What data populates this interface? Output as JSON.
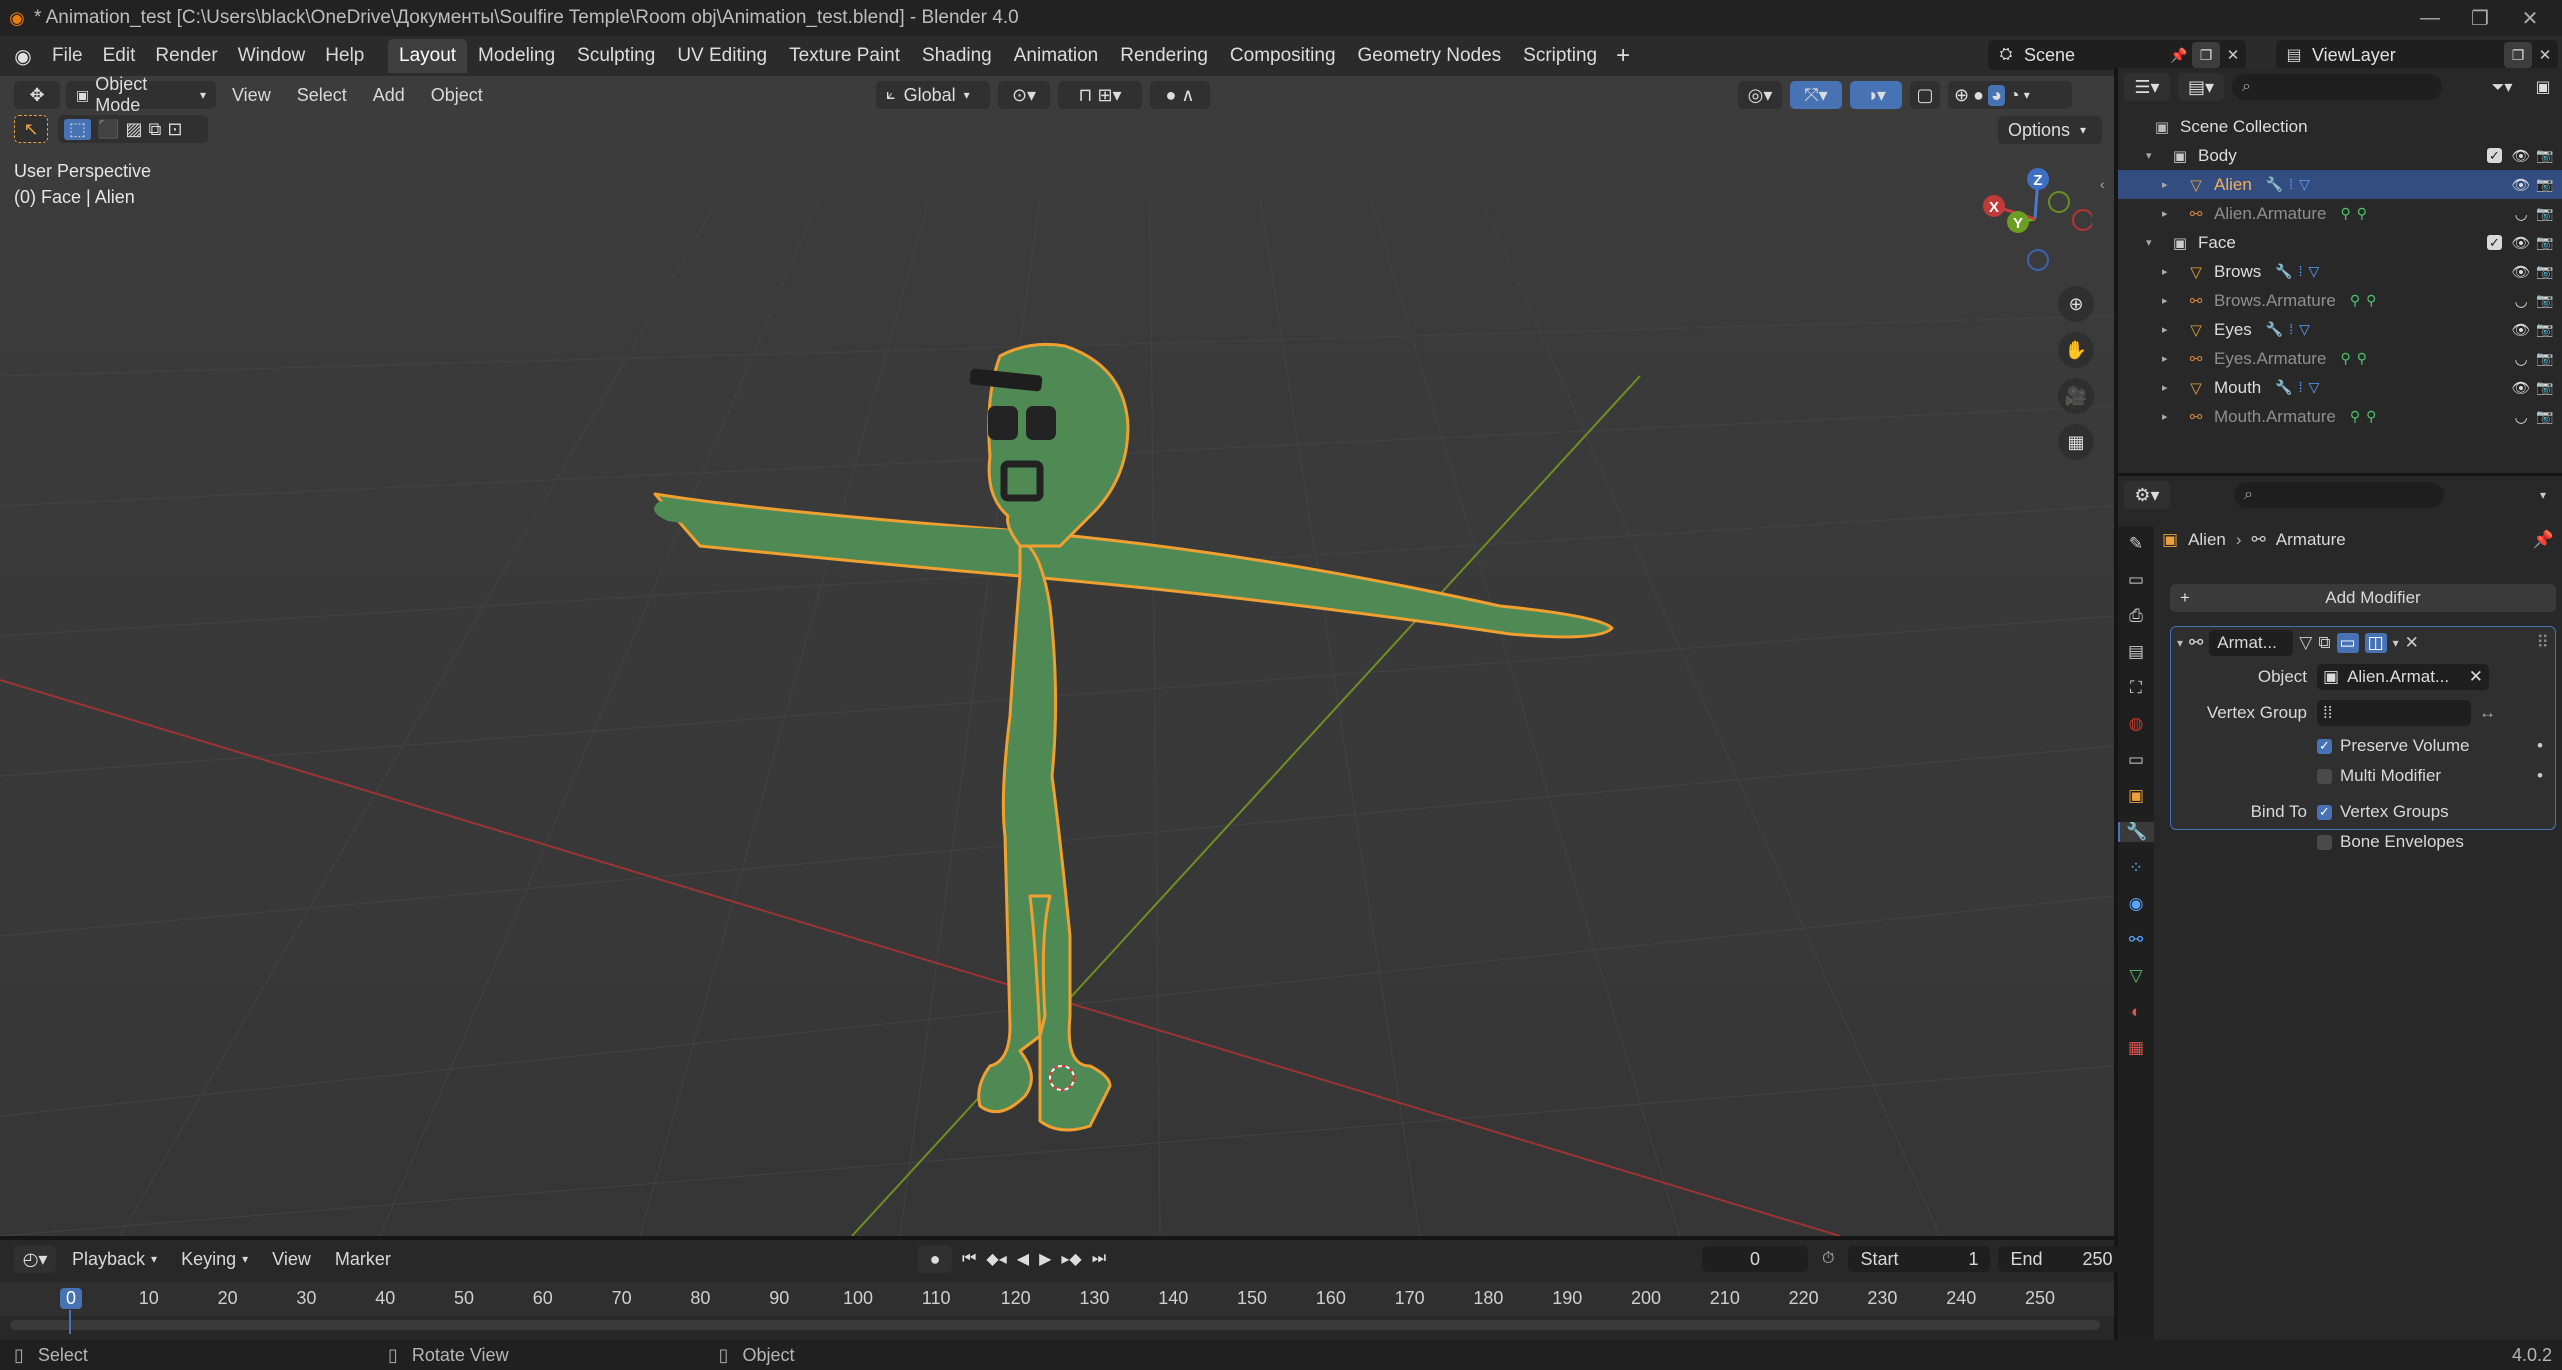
{
  "window": {
    "title": "* Animation_test [C:\\Users\\black\\OneDrive\\Документы\\Soulfire Temple\\Room obj\\Animation_test.blend] - Blender 4.0",
    "minimize": "—",
    "maximize": "❐",
    "close": "✕"
  },
  "menubar": {
    "items": [
      "File",
      "Edit",
      "Render",
      "Window",
      "Help"
    ]
  },
  "workspaces": [
    "Layout",
    "Modeling",
    "Sculpting",
    "UV Editing",
    "Texture Paint",
    "Shading",
    "Animation",
    "Rendering",
    "Compositing",
    "Geometry Nodes",
    "Scripting"
  ],
  "add_workspace": "+",
  "scene": {
    "label": "Scene",
    "view_layer": "ViewLayer"
  },
  "viewport_header": {
    "mode": "Object Mode",
    "menus": [
      "View",
      "Select",
      "Add",
      "Object"
    ],
    "orientation": "Global",
    "options": "Options"
  },
  "viewport": {
    "perspective": "User Perspective",
    "context": "(0) Face | Alien",
    "gizmo": {
      "z": "Z",
      "y": "Y",
      "x": "X"
    }
  },
  "outliner": {
    "collection": "Scene Collection",
    "rows": [
      {
        "name": "Body",
        "kind": "collection",
        "indent": 1
      },
      {
        "name": "Alien",
        "kind": "mesh",
        "indent": 2,
        "selected": true
      },
      {
        "name": "Alien.Armature",
        "kind": "armature",
        "indent": 2
      },
      {
        "name": "Face",
        "kind": "collection",
        "indent": 1
      },
      {
        "name": "Brows",
        "kind": "mesh",
        "indent": 2
      },
      {
        "name": "Brows.Armature",
        "kind": "armature",
        "indent": 2
      },
      {
        "name": "Eyes",
        "kind": "mesh",
        "indent": 2
      },
      {
        "name": "Eyes.Armature",
        "kind": "armature",
        "indent": 2
      },
      {
        "name": "Mouth",
        "kind": "mesh",
        "indent": 2
      },
      {
        "name": "Mouth.Armature",
        "kind": "armature",
        "indent": 2
      }
    ]
  },
  "properties": {
    "breadcrumb_object": "Alien",
    "breadcrumb_sep": "›",
    "breadcrumb_mod": "Armature",
    "add_modifier": "Add Modifier",
    "modifier": {
      "name": "Armat...",
      "object_label": "Object",
      "object_value": "Alien.Armat...",
      "vertex_group_label": "Vertex Group",
      "preserve_volume": "Preserve Volume",
      "multi_modifier": "Multi Modifier",
      "bind_to": "Bind To",
      "vertex_groups": "Vertex Groups",
      "bone_envelopes": "Bone Envelopes"
    }
  },
  "timeline": {
    "menus": [
      "Playback",
      "Keying",
      "View",
      "Marker"
    ],
    "current_frame": "0",
    "start_label": "Start",
    "start": "1",
    "end_label": "End",
    "end": "250",
    "ticks": [
      "0",
      "10",
      "20",
      "30",
      "40",
      "50",
      "60",
      "70",
      "80",
      "90",
      "100",
      "110",
      "120",
      "130",
      "140",
      "150",
      "160",
      "170",
      "180",
      "190",
      "200",
      "210",
      "220",
      "230",
      "240",
      "250"
    ]
  },
  "statusbar": {
    "select": "Select",
    "rotate": "Rotate View",
    "object": "Object",
    "version": "4.0.2"
  },
  "colors": {
    "accent": "#4772b3",
    "select_outline": "#f5a623",
    "mesh": "#4f8a4f",
    "x_axis": "#a33a3a",
    "y_axis": "#6b8e23"
  }
}
